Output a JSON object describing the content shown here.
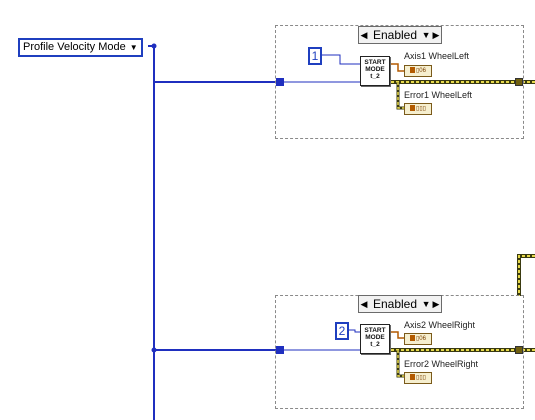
{
  "enum_constant": {
    "label": "Profile Velocity Mode"
  },
  "case_structures": [
    {
      "selector_value": "Enabled",
      "numeric_constant": "1",
      "subvi_label": "START\nMODE\nt_2",
      "axis_label": "Axis1 WheelLeft",
      "error_label": "Error1 WheelLeft"
    },
    {
      "selector_value": "Enabled",
      "numeric_constant": "2",
      "subvi_label": "START\nMODE\nt_2",
      "axis_label": "Axis2 WheelRight",
      "error_label": "Error2 WheelRight"
    }
  ],
  "colors": {
    "wire_blue": "#1f2fbf",
    "wire_error": "#8a7a10",
    "case_border": "#8a8a8a"
  },
  "icons": {
    "enum_dropdown": "triangle-down",
    "selector_left": "triangle-left",
    "selector_right": "triangle-right",
    "indicator_type": "cluster-indicator"
  }
}
